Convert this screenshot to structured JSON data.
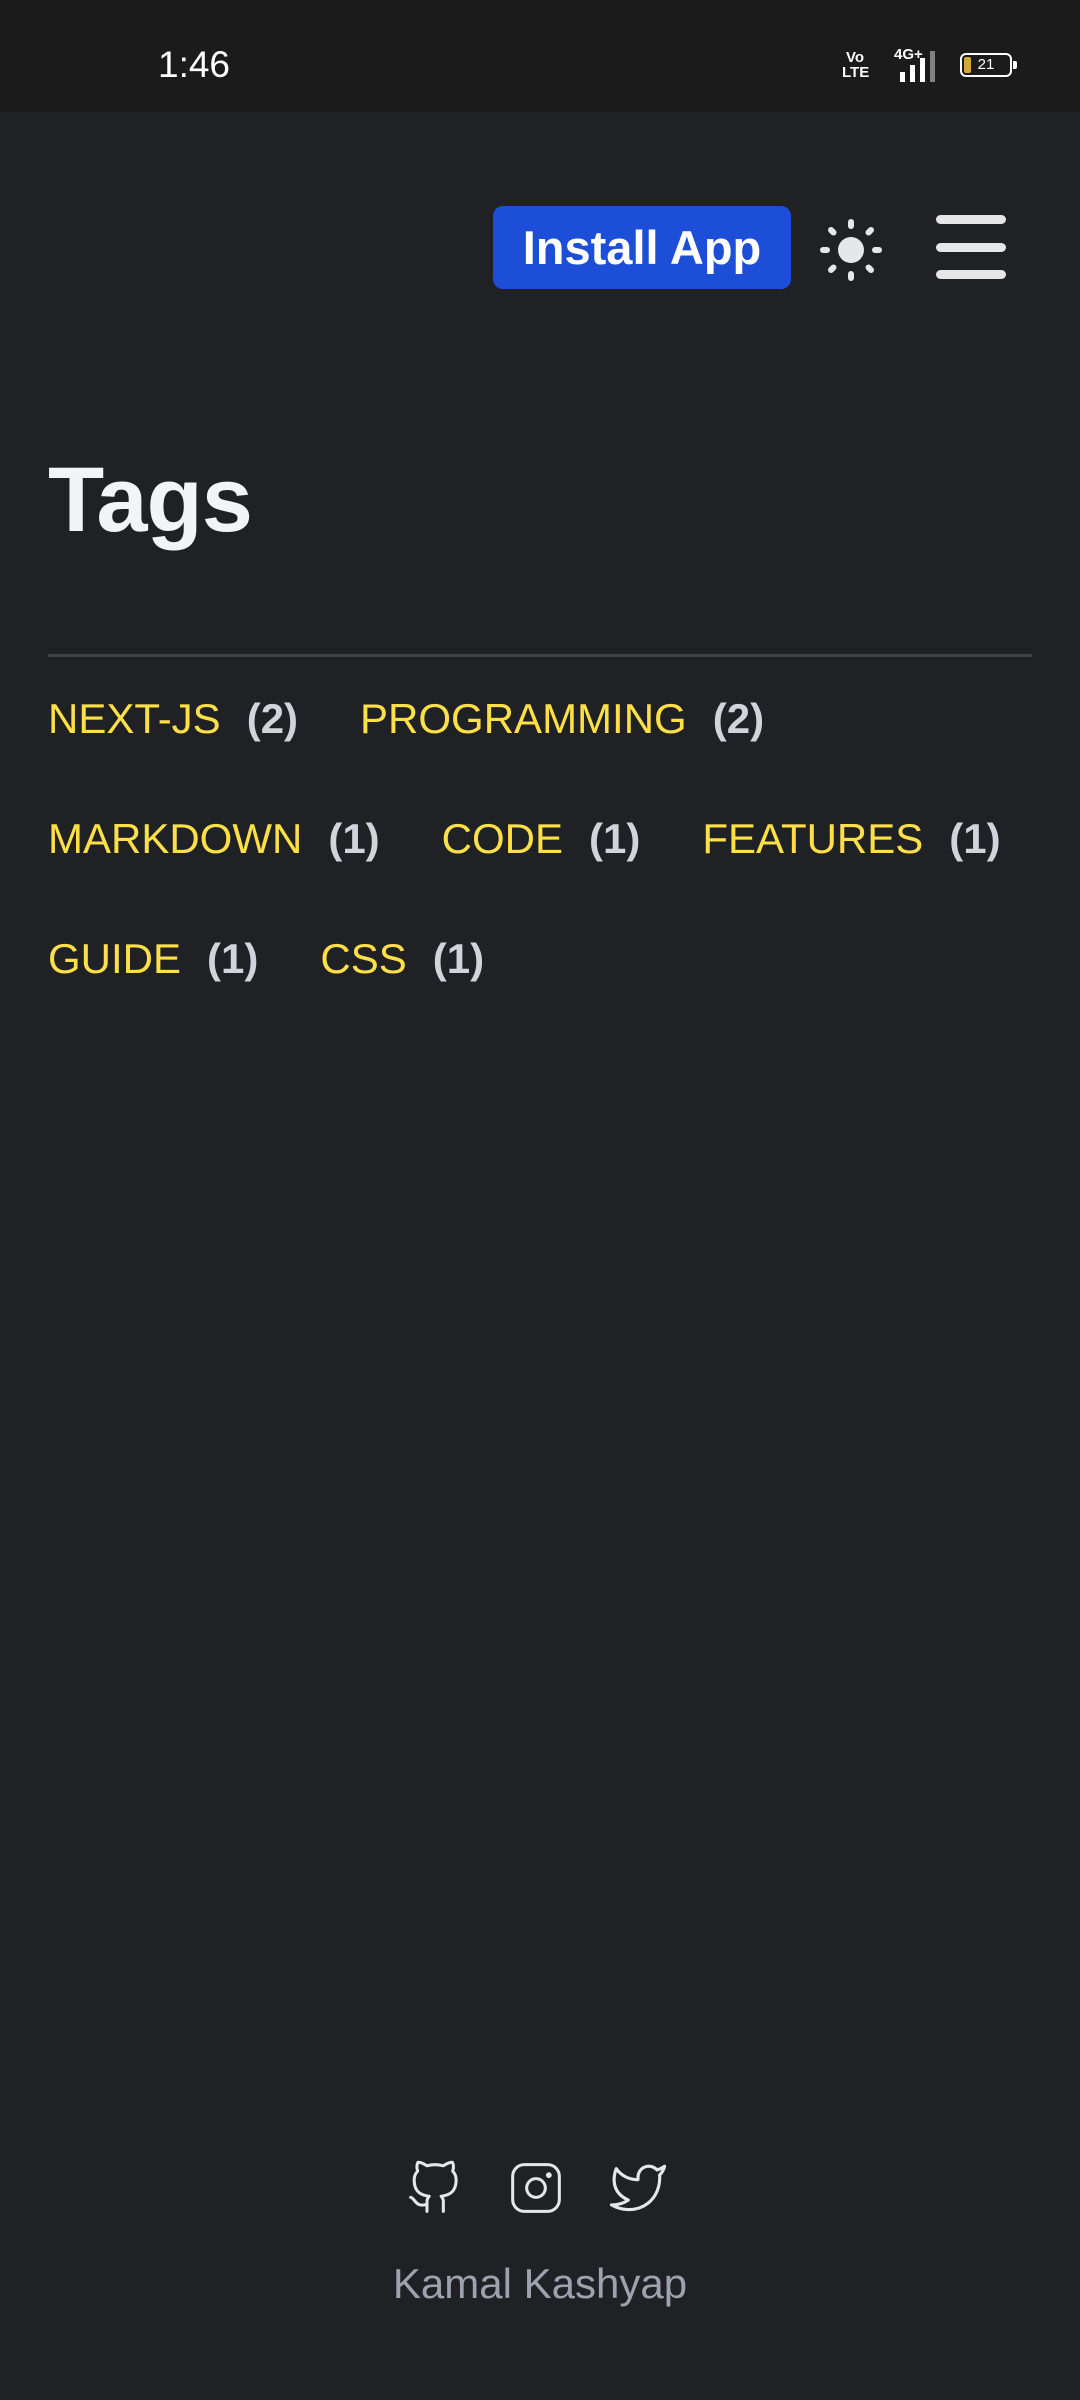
{
  "status_bar": {
    "time": "1:46",
    "volte": "Vo\nLTE",
    "network": "4G+",
    "battery": "21"
  },
  "header": {
    "install_label": "Install App",
    "theme_icon": "sun-icon",
    "menu_icon": "hamburger-menu-icon"
  },
  "page": {
    "title": "Tags"
  },
  "tags": [
    {
      "name": "NEXT-JS",
      "count": "(2)"
    },
    {
      "name": "PROGRAMMING",
      "count": "(2)"
    },
    {
      "name": "MARKDOWN",
      "count": "(1)"
    },
    {
      "name": "CODE",
      "count": "(1)"
    },
    {
      "name": "FEATURES",
      "count": "(1)"
    },
    {
      "name": "GUIDE",
      "count": "(1)"
    },
    {
      "name": "CSS",
      "count": "(1)"
    }
  ],
  "footer": {
    "social_icons": [
      "github-icon",
      "instagram-icon",
      "twitter-icon"
    ],
    "author": "Kamal Kashyap"
  },
  "colors": {
    "background": "#202125",
    "accent_button": "#1d4ed8",
    "tag_name": "#fde047",
    "tag_count": "#d1d5db"
  }
}
